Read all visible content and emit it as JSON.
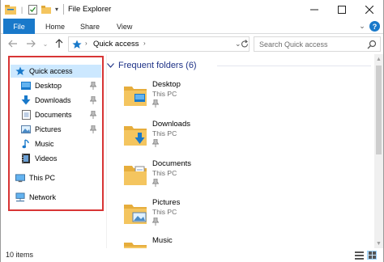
{
  "window": {
    "title": "File Explorer"
  },
  "ribbon": {
    "tabs": [
      {
        "label": "File"
      },
      {
        "label": "Home"
      },
      {
        "label": "Share"
      },
      {
        "label": "View"
      }
    ]
  },
  "address": {
    "path_label": "Quick access"
  },
  "search": {
    "placeholder": "Search Quick access"
  },
  "nav": {
    "items": [
      {
        "label": "Quick access",
        "icon": "star-icon",
        "selected": true
      },
      {
        "label": "Desktop",
        "icon": "desktop-folder-icon",
        "pinned": true
      },
      {
        "label": "Downloads",
        "icon": "download-arrow-icon",
        "pinned": true
      },
      {
        "label": "Documents",
        "icon": "documents-icon",
        "pinned": true
      },
      {
        "label": "Pictures",
        "icon": "pictures-icon",
        "pinned": true
      },
      {
        "label": "Music",
        "icon": "music-note-icon"
      },
      {
        "label": "Videos",
        "icon": "videos-icon"
      },
      {
        "label": "This PC",
        "icon": "computer-icon"
      },
      {
        "label": "Network",
        "icon": "network-icon"
      }
    ]
  },
  "content": {
    "section_title": "Frequent folders (6)",
    "folders": [
      {
        "name": "Desktop",
        "location": "This PC"
      },
      {
        "name": "Downloads",
        "location": "This PC"
      },
      {
        "name": "Documents",
        "location": "This PC"
      },
      {
        "name": "Pictures",
        "location": "This PC"
      },
      {
        "name": "Music",
        "location": ""
      }
    ]
  },
  "status": {
    "item_count": "10 items"
  },
  "colors": {
    "accent": "#1979ca",
    "highlight_box": "#d83535",
    "section_title": "#1e3287",
    "selection": "#cce8ff",
    "folder": "#f4c55f"
  }
}
